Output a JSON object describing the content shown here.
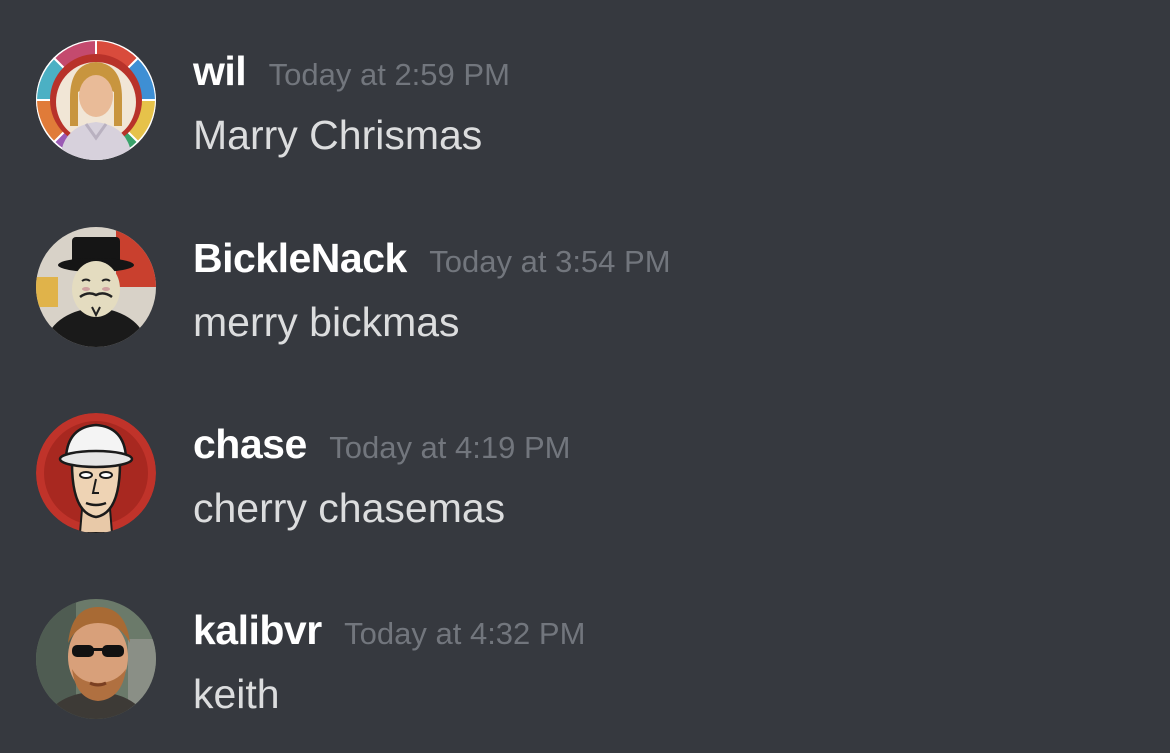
{
  "theme": {
    "background": "#36393f",
    "username_color": "#ffffff",
    "timestamp_color": "#72767d",
    "text_color": "#dcddde"
  },
  "messages": [
    {
      "username": "wil",
      "timestamp": "Today at 2:59 PM",
      "content": "Marry Chrismas",
      "avatar": "stained-glass-portrait-avatar"
    },
    {
      "username": "BickleNack",
      "timestamp": "Today at 3:54 PM",
      "content": "merry bickmas",
      "avatar": "guy-fawkes-mask-avatar"
    },
    {
      "username": "chase",
      "timestamp": "Today at 4:19 PM",
      "content": "cherry chasemas",
      "avatar": "bucket-hat-cartoon-avatar"
    },
    {
      "username": "kalibvr",
      "timestamp": "Today at 4:32 PM",
      "content": "keith",
      "avatar": "sunglasses-portrait-avatar"
    }
  ]
}
